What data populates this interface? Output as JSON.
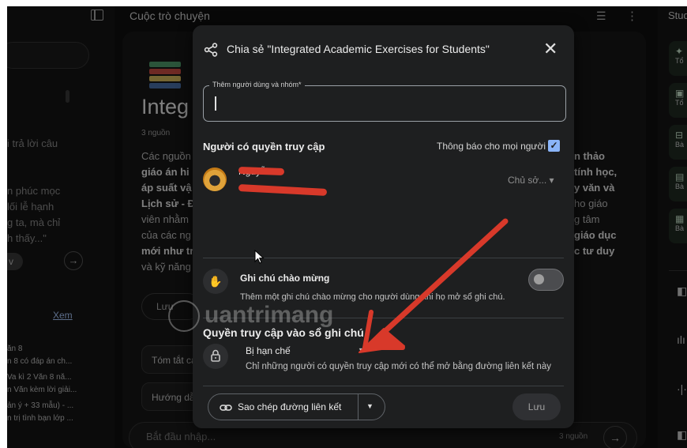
{
  "center": {
    "header_title": "Cuộc trò chuyện",
    "notebook_title": "Integ",
    "sources_count": "3 nguồn",
    "summary_lines": [
      "Các nguồn",
      "giáo án hi",
      "áp suất vậ",
      "Lịch sử - Đ",
      "viên nhằm",
      "của các ng",
      "mới như tr",
      "và kỹ năng"
    ],
    "right_summary_lines": [
      "n thảo",
      "tính học,",
      "y văn và",
      "ho giáo",
      "g tâm",
      "giáo dục",
      "c tư duy"
    ],
    "note_chip": "Lưu",
    "suggestions": [
      "Tóm tắt cá",
      "Hướng dẫ"
    ],
    "chat_placeholder": "Bắt đầu nhập...",
    "chat_count": "3 nguồn"
  },
  "left_panel": {
    "text_lines": [
      "i trả lời câu",
      "n phúc mọc",
      "lối lễ hạnh",
      "g ta, mà chỉ",
      "h thấy...\""
    ],
    "pill": "v",
    "view_link": "Xem",
    "items": [
      {
        "title": "ăn 8",
        "sub": "n 8 có đáp án ch..."
      },
      {
        "title": "Va kì 2 Văn 8 nă...",
        "sub": "n Văn kèm lời giải..."
      },
      {
        "title": "ản ý + 33 mẫu) - ...",
        "sub": "n trị tình bạn lớp ..."
      }
    ]
  },
  "right_panel": {
    "title": "Studio",
    "tiles": [
      "Tổ",
      "Tổ",
      "Bà",
      "Bà",
      "Bà"
    ]
  },
  "dialog": {
    "title": "Chia sẻ \"Integrated Academic Exercises for Students\"",
    "add_field_label": "Thêm người dùng và nhóm*",
    "add_field_value": "",
    "people_section": "Người có quyền truy cập",
    "notify_label": "Thông báo cho mọi người",
    "notify_checked": true,
    "user_name": "Nguyễn",
    "user_role": "Chủ sở... ▾",
    "welcome_title": "Ghi chú chào mừng",
    "welcome_desc": "Thêm một ghi chú chào mừng cho người dùng khi họ mở sổ ghi chú.",
    "welcome_enabled": false,
    "access_title": "Quyền truy cập vào sổ ghi chú",
    "access_value": "Bị hạn chế",
    "access_desc": "Chỉ những người có quyền truy cập mới có thể mở bằng đường liên kết này",
    "copy_link": "Sao chép đường liên kết",
    "save": "Lưu"
  },
  "watermark": "uantrimang",
  "colors": {
    "accent": "#8ab4f8",
    "annotation": "#d8392a",
    "dialog_bg": "#1e1f20",
    "page_bg": "#0f0f0f"
  }
}
